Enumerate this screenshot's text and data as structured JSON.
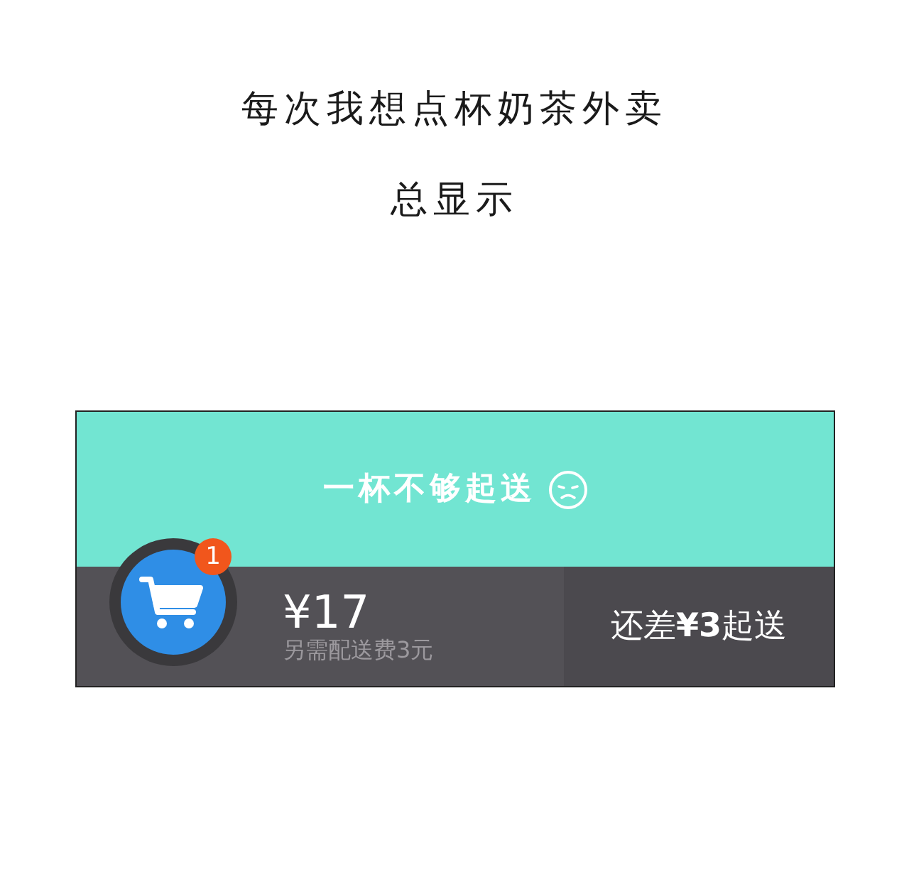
{
  "caption": {
    "lines": [
      "每次我想点杯奶茶外卖",
      "总显示"
    ]
  },
  "notice": {
    "text": "一杯不够起送"
  },
  "cart_bar": {
    "badge": "1",
    "price": "¥17",
    "delivery_fee": "另需配送费3元",
    "checkout": "还差**¥3**起送"
  }
}
